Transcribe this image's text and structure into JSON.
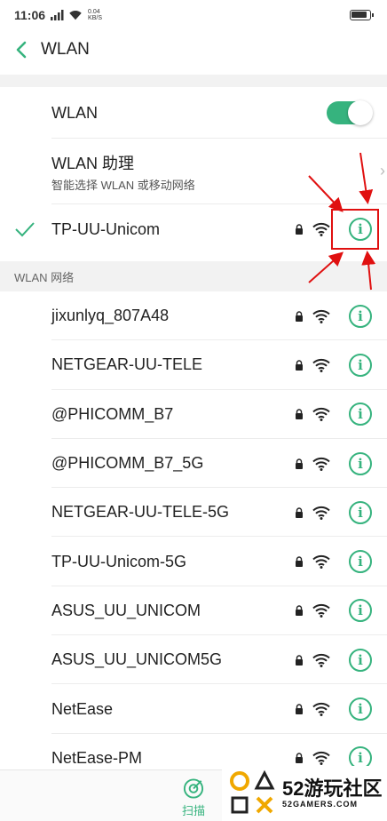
{
  "status_bar": {
    "time": "11:06",
    "network_speed_value": "0.04",
    "network_speed_unit": "KB/S"
  },
  "header": {
    "title": "WLAN"
  },
  "wlan_toggle": {
    "label": "WLAN",
    "state": "on"
  },
  "wlan_assistant": {
    "title": "WLAN 助理",
    "subtitle": "智能选择 WLAN 或移动网络"
  },
  "connected_network": {
    "name": "TP-UU-Unicom"
  },
  "networks_section": {
    "title": "WLAN 网络",
    "items": [
      {
        "name": "jixunlyq_807A48"
      },
      {
        "name": "NETGEAR-UU-TELE"
      },
      {
        "name": "@PHICOMM_B7"
      },
      {
        "name": "@PHICOMM_B7_5G"
      },
      {
        "name": "NETGEAR-UU-TELE-5G"
      },
      {
        "name": "TP-UU-Unicom-5G"
      },
      {
        "name": "ASUS_UU_UNICOM"
      },
      {
        "name": "ASUS_UU_UNICOM5G"
      },
      {
        "name": "NetEase"
      },
      {
        "name": "NetEase-PM"
      }
    ]
  },
  "bottom_bar": {
    "scan_label": "扫描"
  },
  "watermark": {
    "title": "52游玩社区",
    "subtitle": "52GAMERS.COM"
  },
  "colors": {
    "accent": "#36b37e",
    "annotation": "#e01010"
  }
}
